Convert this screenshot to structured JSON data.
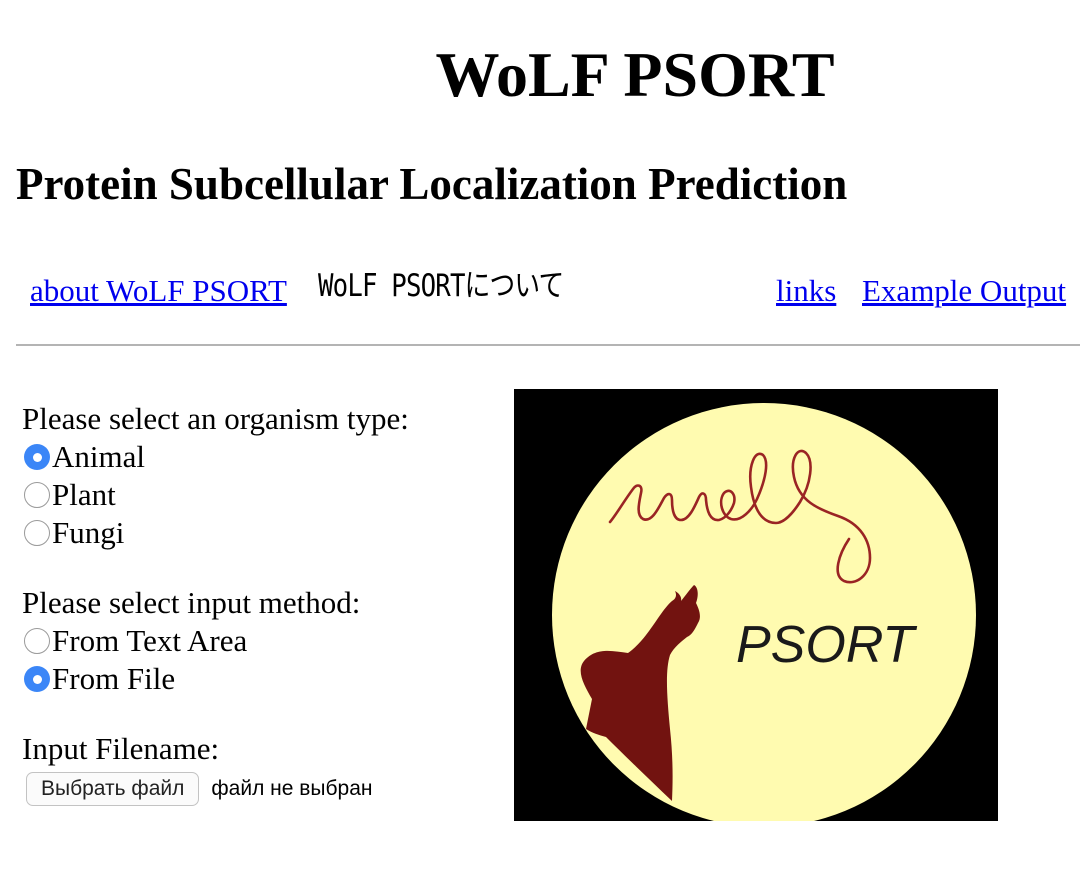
{
  "header": {
    "title": "WoLF PSORT",
    "subtitle": "Protein Subcellular Localization Prediction"
  },
  "nav": {
    "about": "about WoLF PSORT",
    "about_jp": "WoLF PSORTについて",
    "links": "links",
    "example": "Example Output"
  },
  "form": {
    "organism_prompt": "Please select an organism type:",
    "organism_options": [
      {
        "label": "Animal",
        "selected": true
      },
      {
        "label": "Plant",
        "selected": false
      },
      {
        "label": "Fungi",
        "selected": false
      }
    ],
    "method_prompt": "Please select input method:",
    "method_options": [
      {
        "label": "From Text Area",
        "selected": false
      },
      {
        "label": "From File",
        "selected": true
      }
    ],
    "filename_label": "Input Filename:",
    "file_button": "Выбрать файл",
    "file_status": "файл не выбран"
  },
  "logo": {
    "handwriting": "wolf",
    "text": "PSORT",
    "colors": {
      "background": "#000000",
      "moon": "#fffbb0",
      "wolf": "#721310"
    }
  }
}
